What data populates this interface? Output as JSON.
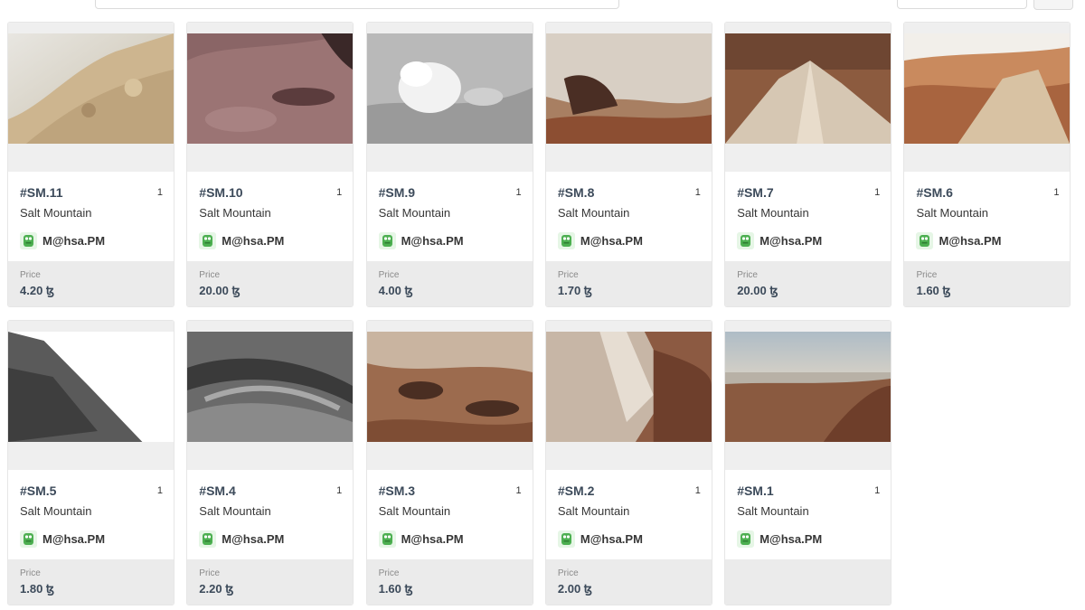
{
  "price_label": "Price",
  "items": [
    {
      "id": "#SM.11",
      "qty": "1",
      "collection": "Salt Mountain",
      "creator": "M@hsa.PM",
      "price": "4.20 ꜩ"
    },
    {
      "id": "#SM.10",
      "qty": "1",
      "collection": "Salt Mountain",
      "creator": "M@hsa.PM",
      "price": "20.00 ꜩ"
    },
    {
      "id": "#SM.9",
      "qty": "1",
      "collection": "Salt Mountain",
      "creator": "M@hsa.PM",
      "price": "4.00 ꜩ"
    },
    {
      "id": "#SM.8",
      "qty": "1",
      "collection": "Salt Mountain",
      "creator": "M@hsa.PM",
      "price": "1.70 ꜩ"
    },
    {
      "id": "#SM.7",
      "qty": "1",
      "collection": "Salt Mountain",
      "creator": "M@hsa.PM",
      "price": "20.00 ꜩ"
    },
    {
      "id": "#SM.6",
      "qty": "1",
      "collection": "Salt Mountain",
      "creator": "M@hsa.PM",
      "price": "1.60 ꜩ"
    },
    {
      "id": "#SM.5",
      "qty": "1",
      "collection": "Salt Mountain",
      "creator": "M@hsa.PM",
      "price": "1.80 ꜩ"
    },
    {
      "id": "#SM.4",
      "qty": "1",
      "collection": "Salt Mountain",
      "creator": "M@hsa.PM",
      "price": "2.20 ꜩ"
    },
    {
      "id": "#SM.3",
      "qty": "1",
      "collection": "Salt Mountain",
      "creator": "M@hsa.PM",
      "price": "1.60 ꜩ"
    },
    {
      "id": "#SM.2",
      "qty": "1",
      "collection": "Salt Mountain",
      "creator": "M@hsa.PM",
      "price": "2.00 ꜩ"
    },
    {
      "id": "#SM.1",
      "qty": "1",
      "collection": "Salt Mountain",
      "creator": "M@hsa.PM",
      "price": ""
    }
  ]
}
